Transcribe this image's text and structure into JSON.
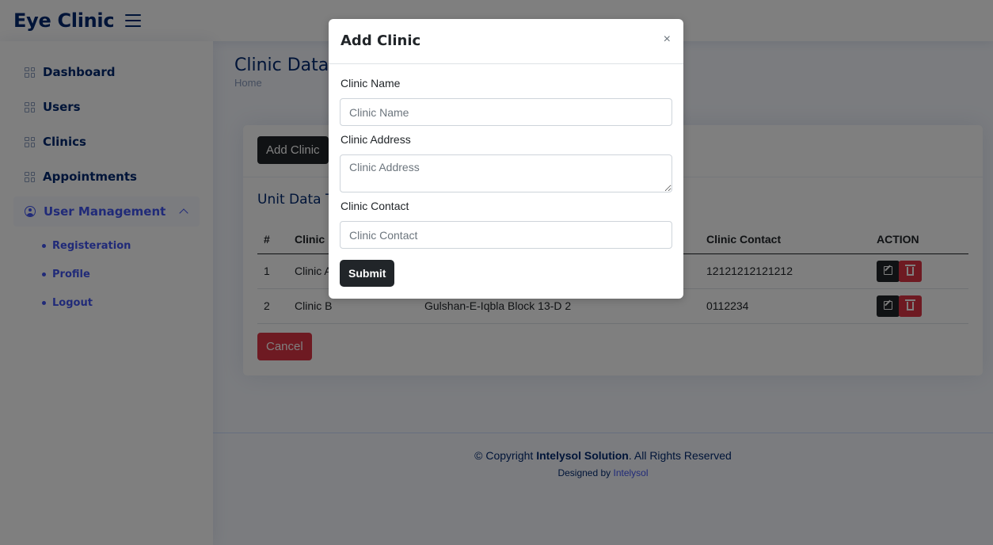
{
  "header": {
    "app_title": "Eye Clinic"
  },
  "sidebar": {
    "items": [
      {
        "label": "Dashboard"
      },
      {
        "label": "Users"
      },
      {
        "label": "Clinics"
      },
      {
        "label": "Appointments"
      },
      {
        "label": "User Management"
      }
    ],
    "sub_items": [
      {
        "label": "Registeration"
      },
      {
        "label": "Profile"
      },
      {
        "label": "Logout"
      }
    ]
  },
  "page": {
    "title": "Clinic Data",
    "breadcrumb": "Home",
    "add_button": "Add Clinic",
    "card_title": "Unit Data T",
    "cancel_button": "Cancel"
  },
  "table": {
    "headers": [
      "#",
      "Clinic",
      "Clinic Contact",
      "ACTION"
    ],
    "rows": [
      {
        "num": "1",
        "name": "Clinic A",
        "address": "",
        "contact": "12121212121212"
      },
      {
        "num": "2",
        "name": "Clinic B",
        "address": "Gulshan-E-Iqbla Block 13-D 2",
        "contact": "0112234"
      }
    ]
  },
  "footer": {
    "copyright_prefix": "© Copyright ",
    "company": "Intelysol Solution",
    "rights": ". All Rights Reserved",
    "designed_by": "Designed by ",
    "designer_link": "Intelysol"
  },
  "modal": {
    "title": "Add Clinic",
    "close": "×",
    "name_label": "Clinic Name",
    "name_placeholder": "Clinic Name",
    "address_label": "Clinic Address",
    "address_placeholder": "Clinic Address",
    "contact_label": "Clinic Contact",
    "contact_placeholder": "Clinic Contact",
    "submit": "Submit"
  }
}
